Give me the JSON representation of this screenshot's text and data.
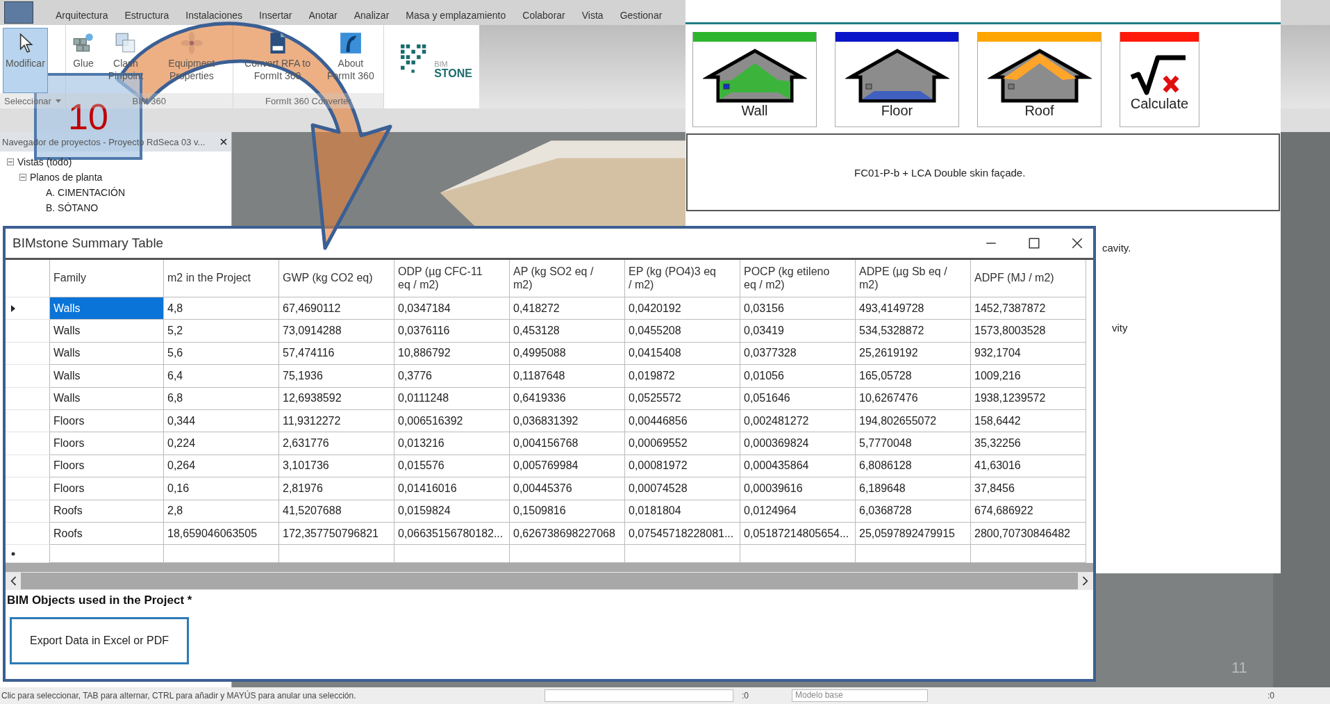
{
  "revit": {
    "menu_tabs": [
      "Arquitectura",
      "Estructura",
      "Instalaciones",
      "Insertar",
      "Anotar",
      "Analizar",
      "Masa y emplazamiento",
      "Colaborar",
      "Vista",
      "Gestionar"
    ],
    "ribbon": {
      "panels": [
        {
          "label": "Seleccionar",
          "dropdown": true,
          "tools": [
            {
              "label": "Modificar",
              "kind": "pointer",
              "selected": true
            }
          ]
        },
        {
          "label": "BIM 360",
          "dropdown": false,
          "tools": [
            {
              "label": "Glue",
              "kind": "cubes",
              "selected": false
            },
            {
              "label": "Clash Pinpoint",
              "kind": "clash",
              "selected": false
            },
            {
              "label": "Equipment Properties",
              "kind": "fan",
              "selected": false
            }
          ]
        },
        {
          "label": "FormIt 360 Converter",
          "dropdown": false,
          "tools": [
            {
              "label": "Convert RFA to FormIt 360",
              "kind": "rfa",
              "selected": false
            },
            {
              "label": "About FormIt 360",
              "kind": "formit",
              "selected": false
            }
          ]
        }
      ],
      "logo": {
        "top": "BIM",
        "bottom": "STONE"
      }
    },
    "project_browser": {
      "title": "Navegador de proyectos - Proyecto RdSeca 03 v...",
      "tree": [
        {
          "label": "Vistas (todo)",
          "expanded": true,
          "children": [
            {
              "label": "Planos de planta",
              "expanded": true,
              "children": [
                {
                  "label": "A. CIMENTACIÓN"
                },
                {
                  "label": "B. SÓTANO"
                }
              ]
            }
          ]
        }
      ]
    },
    "status_bar": {
      "hint": "Clic para seleccionar, TAB para alternar, CTRL para añadir y MAYÚS para anular una selección.",
      "count": ":0",
      "model": "Modelo base",
      "filter_count": ":0"
    }
  },
  "plugin": {
    "buttons": [
      {
        "label": "Wall",
        "kind": "wall",
        "color": "#2db52d"
      },
      {
        "label": "Floor",
        "kind": "floor",
        "color": "#0a14c8"
      },
      {
        "label": "Roof",
        "kind": "roof",
        "color": "#ffa500"
      },
      {
        "label": "Calculate",
        "kind": "calculate",
        "color": "#ff1a0a"
      }
    ],
    "description": "FC01-P-b + LCA Double skin façade.",
    "partial_lines": [
      "cavity.",
      "vity"
    ]
  },
  "summary_window": {
    "title": "BIMstone Summary Table",
    "columns": [
      "Family",
      "m2 in the Project",
      "GWP (kg CO2 eq)",
      "ODP (µg CFC-11 eq / m2)",
      "AP (kg SO2 eq / m2)",
      "EP (kg (PO4)3 eq / m2)",
      "POCP (kg etileno eq / m2)",
      "ADPE (µg Sb eq / m2)",
      "ADPF (MJ / m2)"
    ],
    "rows": [
      {
        "selected": true,
        "cells": [
          "Walls",
          "4,8",
          "67,4690112",
          "0,0347184",
          "0,418272",
          "0,0420192",
          "0,03156",
          "493,4149728",
          "1452,7387872"
        ]
      },
      {
        "selected": false,
        "cells": [
          "Walls",
          "5,2",
          "73,0914288",
          "0,0376116",
          "0,453128",
          "0,0455208",
          "0,03419",
          "534,5328872",
          "1573,8003528"
        ]
      },
      {
        "selected": false,
        "cells": [
          "Walls",
          "5,6",
          "57,474116",
          "10,886792",
          "0,4995088",
          "0,0415408",
          "0,0377328",
          "25,2619192",
          "932,1704"
        ]
      },
      {
        "selected": false,
        "cells": [
          "Walls",
          "6,4",
          "75,1936",
          "0,3776",
          "0,1187648",
          "0,019872",
          "0,01056",
          "165,05728",
          "1009,216"
        ]
      },
      {
        "selected": false,
        "cells": [
          "Walls",
          "6,8",
          "12,6938592",
          "0,0111248",
          "0,6419336",
          "0,0525572",
          "0,051646",
          "10,6267476",
          "1938,1239572"
        ]
      },
      {
        "selected": false,
        "cells": [
          "Floors",
          "0,344",
          "11,9312272",
          "0,006516392",
          "0,036831392",
          "0,00446856",
          "0,002481272",
          "194,802655072",
          "158,6442"
        ]
      },
      {
        "selected": false,
        "cells": [
          "Floors",
          "0,224",
          "2,631776",
          "0,013216",
          "0,004156768",
          "0,00069552",
          "0,000369824",
          "5,7770048",
          "35,32256"
        ]
      },
      {
        "selected": false,
        "cells": [
          "Floors",
          "0,264",
          "3,101736",
          "0,015576",
          "0,005769984",
          "0,00081972",
          "0,000435864",
          "6,8086128",
          "41,63016"
        ]
      },
      {
        "selected": false,
        "cells": [
          "Floors",
          "0,16",
          "2,81976",
          "0,01416016",
          "0,00445376",
          "0,00074528",
          "0,00039616",
          "6,189648",
          "37,8456"
        ]
      },
      {
        "selected": false,
        "cells": [
          "Roofs",
          "2,8",
          "41,5207688",
          "0,0159824",
          "0,1509816",
          "0,0181804",
          "0,0124964",
          "6,0368728",
          "674,686922"
        ]
      },
      {
        "selected": false,
        "cells": [
          "Roofs",
          "18,659046063505",
          "172,357750796821",
          "0,06635156780182...",
          "0,626738698227068",
          "0,07545718228081...",
          "0,05187214805654...",
          "25,0597892479915",
          "2800,70730846482"
        ]
      }
    ],
    "section_label": "BIM Objects used in the Project *",
    "export_button": "Export Data in Excel or PDF"
  },
  "annotation": {
    "step": "10",
    "page": "11"
  }
}
